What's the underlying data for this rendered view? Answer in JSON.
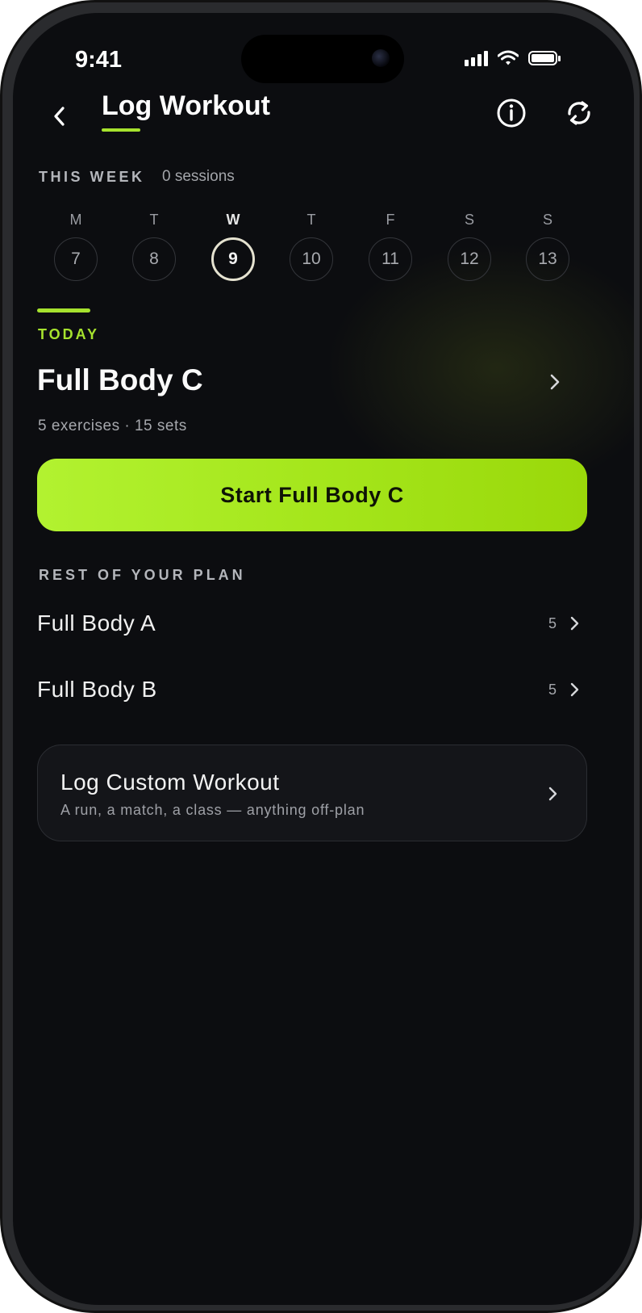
{
  "status_bar": {
    "time": "9:41"
  },
  "header": {
    "title": "Log Workout",
    "back_icon": "chevron-left-icon",
    "info_icon": "info-circle-icon",
    "refresh_icon": "refresh-icon"
  },
  "week": {
    "label": "THIS WEEK",
    "sessions": "0 sessions",
    "days": [
      {
        "letter": "M",
        "date": "7",
        "active": false
      },
      {
        "letter": "T",
        "date": "8",
        "active": false
      },
      {
        "letter": "W",
        "date": "9",
        "active": true
      },
      {
        "letter": "T",
        "date": "10",
        "active": false
      },
      {
        "letter": "F",
        "date": "11",
        "active": false
      },
      {
        "letter": "S",
        "date": "12",
        "active": false
      },
      {
        "letter": "S",
        "date": "13",
        "active": false
      }
    ]
  },
  "today": {
    "label": "TODAY",
    "workout": "Full Body C",
    "meta": "5 exercises · 15 sets",
    "start_label": "Start Full Body C"
  },
  "plan": {
    "label": "REST OF YOUR PLAN",
    "items": [
      {
        "name": "Full Body A",
        "count": "5"
      },
      {
        "name": "Full Body B",
        "count": "5"
      }
    ]
  },
  "custom": {
    "title": "Log Custom Workout",
    "subtitle": "A run, a match, a class — anything off-plan"
  },
  "colors": {
    "accent": "#a6e22e",
    "background": "#0c0d10",
    "card": "#141519"
  }
}
